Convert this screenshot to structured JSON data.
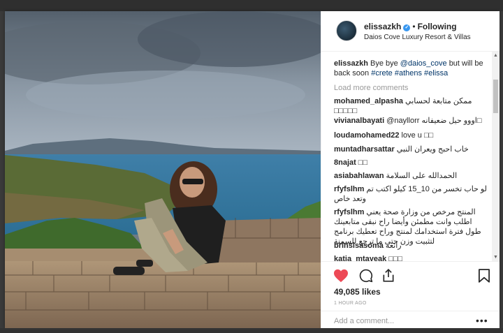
{
  "post": {
    "username": "elissazkh",
    "verified_mark": "✓",
    "separator": "•",
    "follow_status": "Following",
    "location": "Daios Cove Luxury Resort & Villas",
    "caption": {
      "username": "elissazkh",
      "text_1": "Bye bye",
      "mention": "@daios_cove",
      "text_2": "but will be back soon",
      "tags": "#crete #athens #elissa"
    },
    "load_more": "Load more comments",
    "comments": [
      {
        "user": "mohamed_alpasha",
        "text": "ممكن متابعة لحسابي □□□□□"
      },
      {
        "user": "vivianalbayati",
        "text": "@nayllorr اووو حيل ضعيفانه□"
      },
      {
        "user": "loudamohamed22",
        "text": "love u □□"
      },
      {
        "user": "muntadharsattar",
        "text": "خاب احبج ويعران النبي"
      },
      {
        "user": "8najat",
        "text": "□□"
      },
      {
        "user": "asiabahlawan",
        "text": "الحمدالله على السلامة"
      },
      {
        "user": "rfyfslhm",
        "text": "لو حاب تخسر من 10_15 كيلو اكتب تم وتعد خاص"
      },
      {
        "user": "rfyfslhm",
        "text": "المنتج مرخص من وزارة صحة يعني اطلب وانت مطمئن وأيضا راح نبقى متابعينك طول فترة استخدامك لمنتج وراح تعطيك برنامج لتثبيت وزن حتى ما ترجع للسمنة"
      },
      {
        "user": "brinsisasoma",
        "text": "رائعة"
      },
      {
        "user": "katia_mtayeak",
        "text": "□□□"
      }
    ],
    "likes": "49,085 likes",
    "time_ago": "1 HOUR AGO",
    "add_comment_placeholder": "Add a comment...",
    "more_options": "•••",
    "scroll_up": "▲",
    "scroll_down": "▼",
    "colors": {
      "like_red": "#ed4956",
      "link_blue": "#003569",
      "verified_blue": "#3897f0"
    },
    "icons": [
      "heart-icon",
      "comment-icon",
      "share-icon",
      "bookmark-icon"
    ]
  }
}
